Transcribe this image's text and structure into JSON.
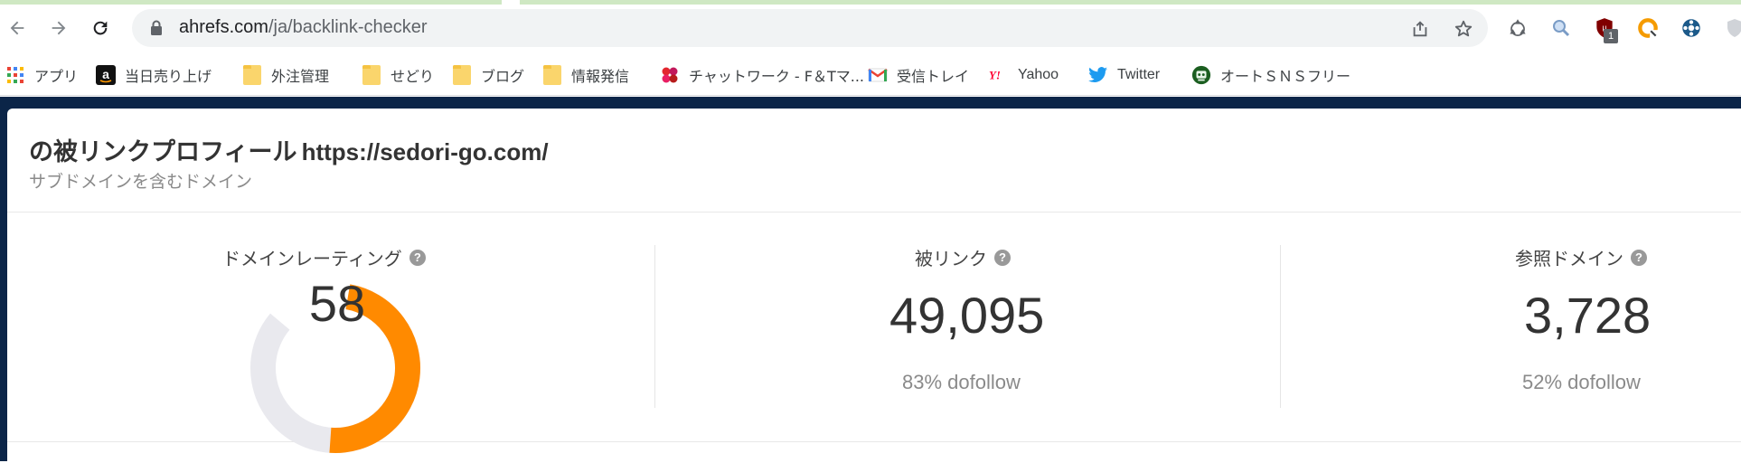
{
  "browser": {
    "url_host": "ahrefs.com",
    "url_path": "/ja/backlink-checker",
    "extension_badge": "1"
  },
  "bookmarks": [
    {
      "label": "アプリ",
      "icon": "apps-grid-icon"
    },
    {
      "label": "当日売り上げ",
      "icon": "amazon-icon"
    },
    {
      "label": "外注管理",
      "icon": "folder-icon"
    },
    {
      "label": "せどり",
      "icon": "folder-icon"
    },
    {
      "label": "ブログ",
      "icon": "folder-icon"
    },
    {
      "label": "情報発信",
      "icon": "folder-icon"
    },
    {
      "label": "チャットワーク - F＆Tマ...",
      "icon": "chatwork-icon"
    },
    {
      "label": "受信トレイ",
      "icon": "gmail-icon"
    },
    {
      "label": "Yahoo",
      "icon": "yahoo-icon"
    },
    {
      "label": "Twitter",
      "icon": "twitter-icon"
    },
    {
      "label": "オートＳＮＳフリー",
      "icon": "robot-icon"
    }
  ],
  "page": {
    "title_jp": "の被リンクプロフィール",
    "title_url": "https://sedori-go.com/",
    "subtitle": "サブドメインを含むドメイン"
  },
  "metrics": {
    "domain_rating": {
      "label": "ドメインレーティング",
      "value": "58",
      "gauge_fraction": 0.58
    },
    "backlinks": {
      "label": "被リンク",
      "value": "49,095",
      "sub": "83% dofollow"
    },
    "referring_domains": {
      "label": "参照ドメイン",
      "value": "3,728",
      "sub": "52% dofollow"
    }
  },
  "colors": {
    "gauge_fill": "#ff8a00",
    "gauge_track": "#e9e9ee",
    "header_dark": "#0b2548"
  }
}
